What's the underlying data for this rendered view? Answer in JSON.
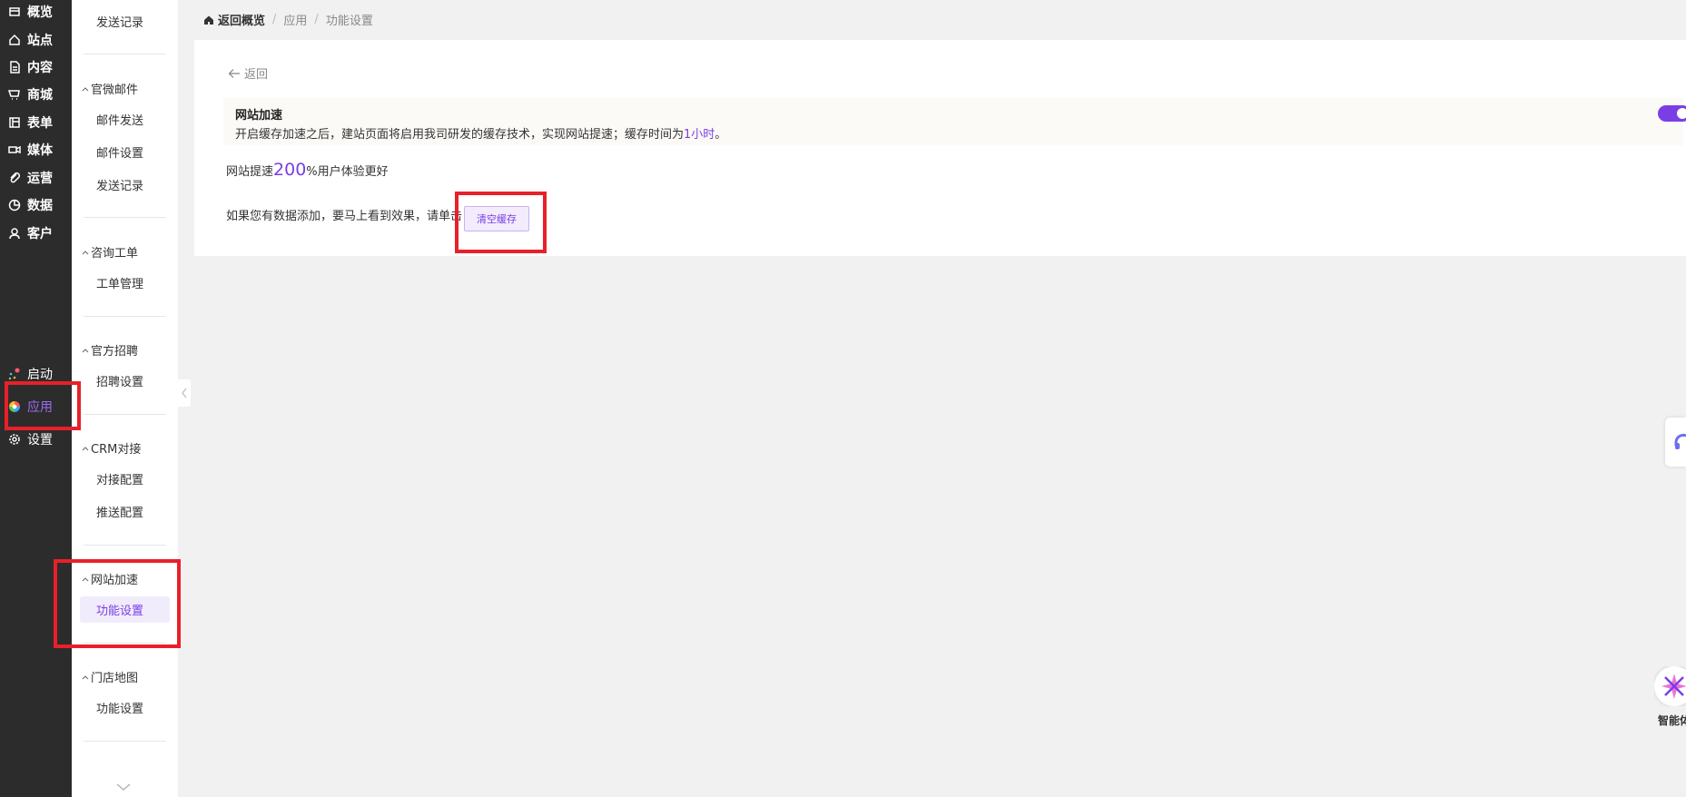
{
  "nav": {
    "items": [
      {
        "label": "概览",
        "icon": "overview-icon"
      },
      {
        "label": "站点",
        "icon": "home-icon"
      },
      {
        "label": "内容",
        "icon": "document-icon"
      },
      {
        "label": "商城",
        "icon": "cart-icon"
      },
      {
        "label": "表单",
        "icon": "form-icon"
      },
      {
        "label": "媒体",
        "icon": "video-icon"
      },
      {
        "label": "运营",
        "icon": "paperclip-icon"
      },
      {
        "label": "数据",
        "icon": "pie-chart-icon"
      },
      {
        "label": "客户",
        "icon": "user-icon"
      }
    ],
    "bottom": [
      {
        "label": "启动",
        "icon": "launch-icon"
      },
      {
        "label": "应用",
        "icon": "apps-icon"
      },
      {
        "label": "设置",
        "icon": "gear-icon"
      }
    ]
  },
  "submenu": {
    "top_item": "发送记录",
    "groups": [
      {
        "title": "官微邮件",
        "items": [
          "邮件发送",
          "邮件设置",
          "发送记录"
        ]
      },
      {
        "title": "咨询工单",
        "items": [
          "工单管理"
        ]
      },
      {
        "title": "官方招聘",
        "items": [
          "招聘设置"
        ]
      },
      {
        "title": "CRM对接",
        "items": [
          "对接配置",
          "推送配置"
        ]
      },
      {
        "title": "网站加速",
        "items": [
          "功能设置"
        ]
      },
      {
        "title": "门店地图",
        "items": [
          "功能设置"
        ]
      }
    ]
  },
  "breadcrumb": {
    "home": "返回概览",
    "sep": "/",
    "level1": "应用",
    "level2": "功能设置"
  },
  "main": {
    "back_label": "返回",
    "notice": {
      "title": "网站加速",
      "desc_prefix": "开启缓存加速之后，建站页面将启用我司研发的缓存技术，实现网站提速；缓存时间为",
      "desc_highlight": "1小时",
      "desc_suffix": "。"
    },
    "toggle_on": true,
    "speed": {
      "prefix": "网站提速",
      "number": "200",
      "suffix": "%用户体验更好"
    },
    "clear": {
      "text": "如果您有数据添加，要马上看到效果，请单击",
      "button": "清空缓存"
    }
  },
  "floating": {
    "ai_label": "智能体"
  },
  "colors": {
    "accent": "#7a3fe4",
    "nav_bg": "#2c2c2c",
    "highlight_red": "#e8202a"
  }
}
